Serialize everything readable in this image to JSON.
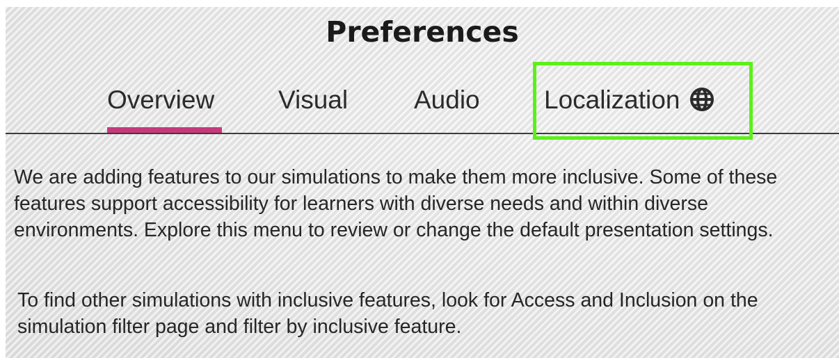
{
  "dialog": {
    "title": "Preferences"
  },
  "tabs": [
    {
      "label": "Overview",
      "selected": true
    },
    {
      "label": "Visual",
      "selected": false
    },
    {
      "label": "Audio",
      "selected": false
    },
    {
      "label": "Localization",
      "selected": false,
      "icon": "globe-icon"
    }
  ],
  "content": {
    "paragraph_1": "We are adding features to our simulations to make them more inclusive. Some of these features support accessibility for learners with diverse needs and within diverse environments. Explore this menu to review or change the default presentation settings.",
    "paragraph_2": "To find other simulations with inclusive features, look for Access and Inclusion on the simulation filter page and filter by inclusive feature."
  },
  "colors": {
    "selected_tab_underline": "#c63a7a",
    "highlight_box": "#5cf01a"
  }
}
